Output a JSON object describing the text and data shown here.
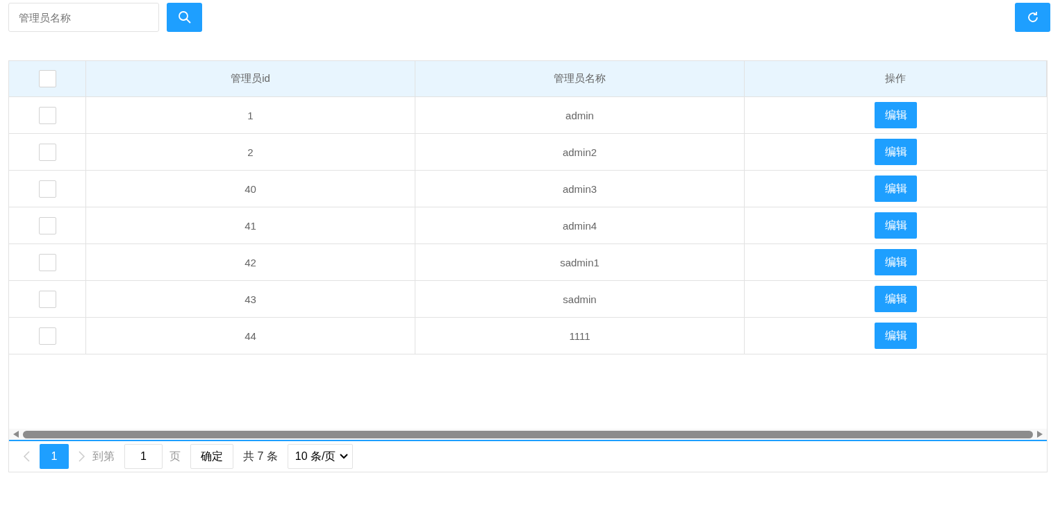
{
  "toolbar": {
    "search": {
      "placeholder": "管理员名称"
    }
  },
  "table": {
    "select_all_checked": false,
    "columns": [
      "管理员id",
      "管理员名称",
      "操作"
    ],
    "rows": [
      {
        "checked": false,
        "id": "1",
        "name": "admin",
        "action": "编辑"
      },
      {
        "checked": false,
        "id": "2",
        "name": "admin2",
        "action": "编辑"
      },
      {
        "checked": false,
        "id": "40",
        "name": "admin3",
        "action": "编辑"
      },
      {
        "checked": false,
        "id": "41",
        "name": "admin4",
        "action": "编辑"
      },
      {
        "checked": false,
        "id": "42",
        "name": "sadmin1",
        "action": "编辑"
      },
      {
        "checked": false,
        "id": "43",
        "name": "sadmin",
        "action": "编辑"
      },
      {
        "checked": false,
        "id": "44",
        "name": "1111",
        "action": "编辑"
      }
    ]
  },
  "pagination": {
    "pages": [
      {
        "label": "1",
        "selected": true
      }
    ],
    "goto_label": "到第",
    "goto_value": "1",
    "page_unit": "页",
    "confirm": "确定",
    "total": "共 7 条",
    "page_size": "10 条/页"
  }
}
